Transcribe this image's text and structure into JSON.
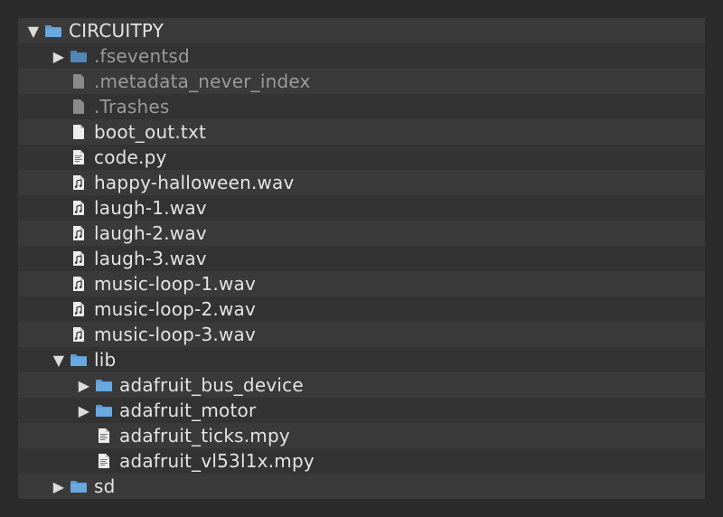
{
  "tree": {
    "rows": [
      {
        "label": "CIRCUITPY",
        "icon": "folder-icon",
        "depth": 0,
        "expander": "expanded",
        "dim": false,
        "alt": true
      },
      {
        "label": ".fseventsd",
        "icon": "folder-icon",
        "depth": 1,
        "expander": "collapsed",
        "dim": true,
        "alt": false
      },
      {
        "label": ".metadata_never_index",
        "icon": "file-icon",
        "depth": 1,
        "expander": "none",
        "dim": true,
        "alt": true
      },
      {
        "label": ".Trashes",
        "icon": "file-icon",
        "depth": 1,
        "expander": "none",
        "dim": true,
        "alt": false
      },
      {
        "label": "boot_out.txt",
        "icon": "text-file-icon",
        "depth": 1,
        "expander": "none",
        "dim": false,
        "alt": true
      },
      {
        "label": "code.py",
        "icon": "code-file-icon",
        "depth": 1,
        "expander": "none",
        "dim": false,
        "alt": false
      },
      {
        "label": "happy-halloween.wav",
        "icon": "audio-file-icon",
        "depth": 1,
        "expander": "none",
        "dim": false,
        "alt": true
      },
      {
        "label": "laugh-1.wav",
        "icon": "audio-file-icon",
        "depth": 1,
        "expander": "none",
        "dim": false,
        "alt": false
      },
      {
        "label": "laugh-2.wav",
        "icon": "audio-file-icon",
        "depth": 1,
        "expander": "none",
        "dim": false,
        "alt": true
      },
      {
        "label": "laugh-3.wav",
        "icon": "audio-file-icon",
        "depth": 1,
        "expander": "none",
        "dim": false,
        "alt": false
      },
      {
        "label": "music-loop-1.wav",
        "icon": "audio-file-icon",
        "depth": 1,
        "expander": "none",
        "dim": false,
        "alt": true
      },
      {
        "label": "music-loop-2.wav",
        "icon": "audio-file-icon",
        "depth": 1,
        "expander": "none",
        "dim": false,
        "alt": false
      },
      {
        "label": "music-loop-3.wav",
        "icon": "audio-file-icon",
        "depth": 1,
        "expander": "none",
        "dim": false,
        "alt": true
      },
      {
        "label": "lib",
        "icon": "folder-icon",
        "depth": 1,
        "expander": "expanded",
        "dim": false,
        "alt": false
      },
      {
        "label": "adafruit_bus_device",
        "icon": "folder-icon",
        "depth": 2,
        "expander": "collapsed",
        "dim": false,
        "alt": true
      },
      {
        "label": "adafruit_motor",
        "icon": "folder-icon",
        "depth": 2,
        "expander": "collapsed",
        "dim": false,
        "alt": false
      },
      {
        "label": "adafruit_ticks.mpy",
        "icon": "code-file-icon",
        "depth": 2,
        "expander": "none",
        "dim": false,
        "alt": true
      },
      {
        "label": "adafruit_vl53l1x.mpy",
        "icon": "code-file-icon",
        "depth": 2,
        "expander": "none",
        "dim": false,
        "alt": false
      },
      {
        "label": "sd",
        "icon": "folder-icon",
        "depth": 1,
        "expander": "collapsed",
        "dim": false,
        "alt": true
      }
    ]
  },
  "colors": {
    "folder": "#5b9bd5",
    "file": "#e6e6e6",
    "row_alt": "#3a3a3a",
    "row": "#333333",
    "text": "#e3e3e3",
    "text_dim": "#9a9a9a"
  }
}
